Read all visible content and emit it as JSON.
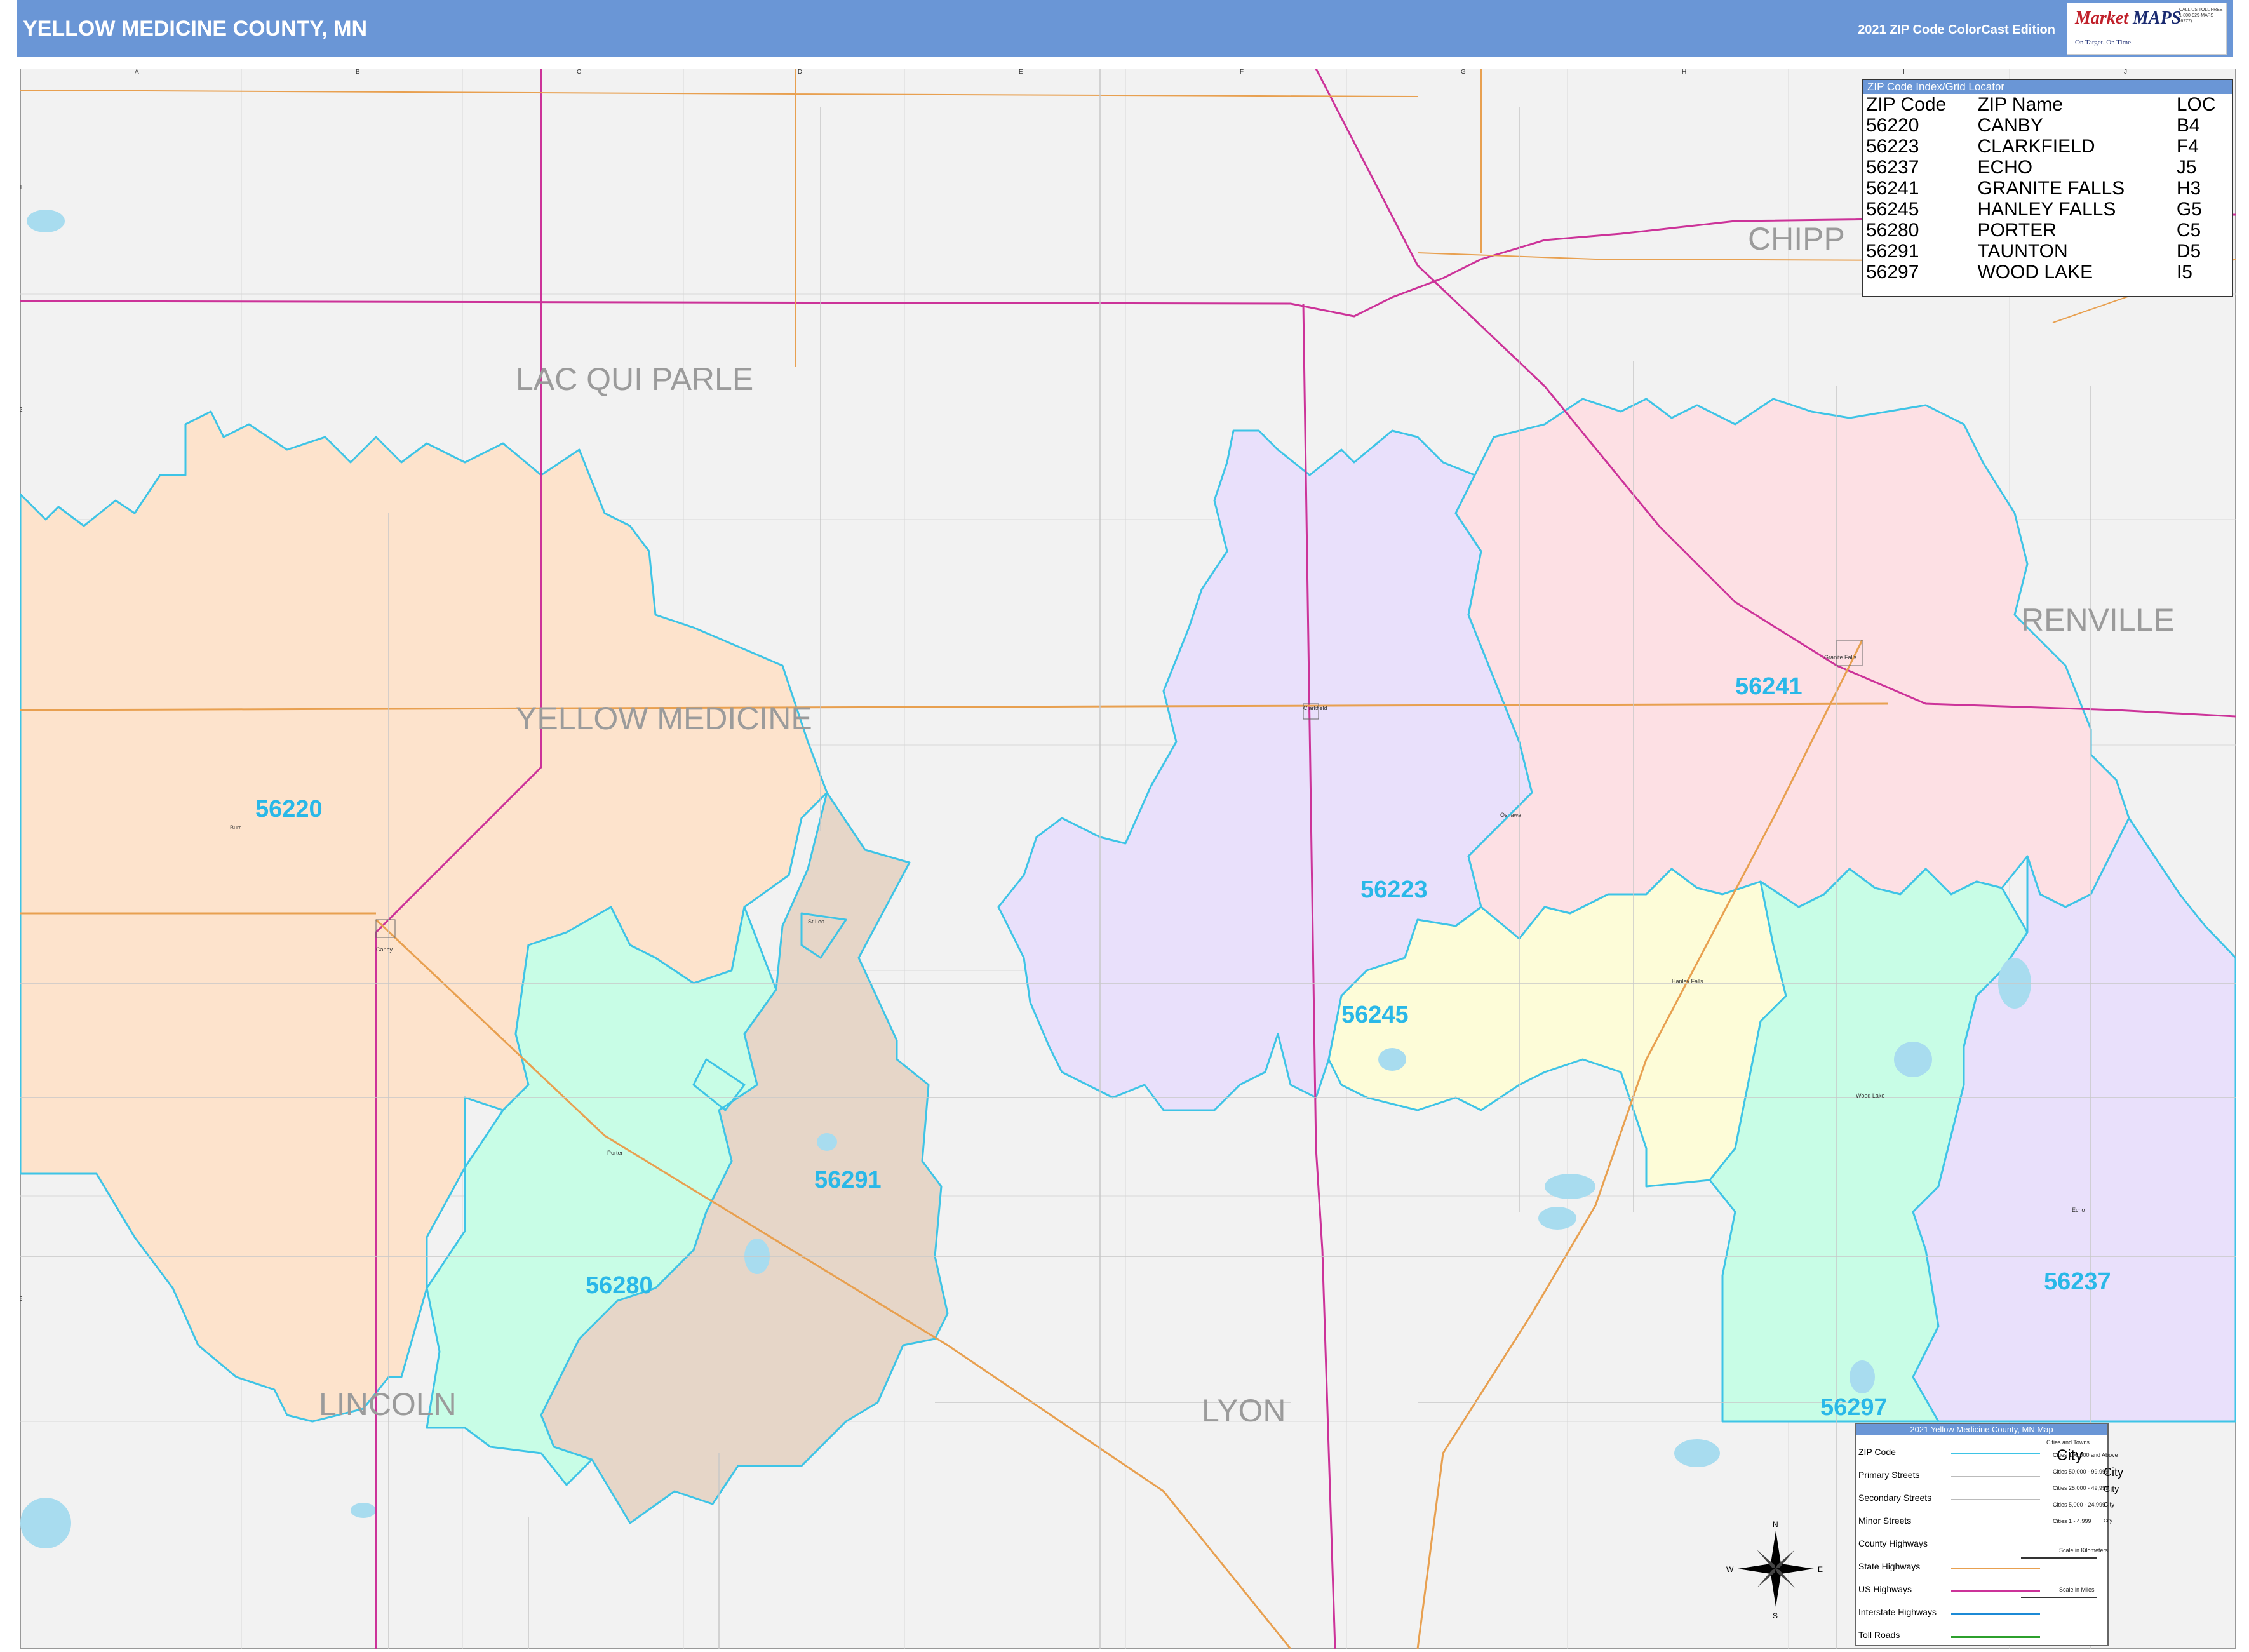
{
  "header": {
    "title": "YELLOW MEDICINE COUNTY, MN",
    "edition": "2021 ZIP Code ColorCast Edition"
  },
  "logo": {
    "name_line1": "Market",
    "name_line2": "MAPS",
    "tagline": "On Target. On Time.",
    "tagline2": "America's Leading Source of Business Maps",
    "contact": "CALL US TOLL FREE 1-800-929-MAPS (6277)"
  },
  "grid": {
    "columns": [
      "A",
      "B",
      "C",
      "D",
      "E",
      "F",
      "G",
      "H",
      "I",
      "J"
    ],
    "rows": [
      "1",
      "2",
      "3",
      "4",
      "5",
      "6",
      "7"
    ]
  },
  "region_labels": {
    "lac_qui_parle": "LAC QUI PARLE",
    "yellow_medicine": "YELLOW MEDICINE",
    "chippewa": "CHIPP",
    "renville": "RENVILLE",
    "lincoln": "LINCOLN",
    "lyon": "LYON"
  },
  "zip_labels": {
    "z56220": "56220",
    "z56223": "56223",
    "z56241": "56241",
    "z56245": "56245",
    "z56291": "56291",
    "z56280": "56280",
    "z56237": "56237",
    "z56297": "56297"
  },
  "town_labels": {
    "canby": "Canby",
    "clarkfield": "Clarkfield",
    "granite_falls": "Granite Falls",
    "hanley_falls": "Hanley Falls",
    "wood_lake": "Wood Lake",
    "porter": "Porter",
    "echo": "Echo",
    "st_leo": "St Leo",
    "burr": "Burr",
    "oshawa": "Oshawa"
  },
  "zip_index": {
    "title": "ZIP Code Index/Grid Locator",
    "headers": [
      "ZIP Code",
      "ZIP Name",
      "LOC"
    ],
    "rows": [
      [
        "56220",
        "CANBY",
        "B4"
      ],
      [
        "56223",
        "CLARKFIELD",
        "F4"
      ],
      [
        "56237",
        "ECHO",
        "J5"
      ],
      [
        "56241",
        "GRANITE FALLS",
        "H3"
      ],
      [
        "56245",
        "HANLEY FALLS",
        "G5"
      ],
      [
        "56280",
        "PORTER",
        "C5"
      ],
      [
        "56291",
        "TAUNTON",
        "D5"
      ],
      [
        "56297",
        "WOOD LAKE",
        "I5"
      ]
    ]
  },
  "legend": {
    "title": "2021 Yellow Medicine County, MN Map",
    "col_header_cities": "Cities and Towns",
    "items": [
      "ZIP Code",
      "Primary Streets",
      "Secondary Streets",
      "Minor Streets",
      "County Highways",
      "State Highways",
      "US Highways",
      "Interstate Highways",
      "Toll Roads"
    ],
    "cities": [
      [
        "Cities 100,000 and Above",
        "City"
      ],
      [
        "Cities 50,000 - 99,999",
        "City"
      ],
      [
        "Cities 25,000 - 49,999",
        "City"
      ],
      [
        "Cities 5,000 - 24,999",
        "City"
      ],
      [
        "Cities 1 - 4,999",
        "City"
      ]
    ],
    "scale_km": "Scale in Kilometers",
    "scale_mi": "Scale in Miles"
  },
  "compass": {
    "n": "N",
    "s": "S",
    "e": "E",
    "w": "W"
  },
  "colors": {
    "header_bg": "#6a96d6",
    "zip_label": "#2ab8e8",
    "zip_boundary": "#3ec4e6",
    "z56220": "#fde3cc",
    "z56223": "#e9e0fb",
    "z56241": "#fde0e4",
    "z56245": "#fdfcd8",
    "z56291": "#e6d6c8",
    "z56280": "#c8fde6",
    "z56237": "#e9e0fb",
    "z56297": "#c8fde6",
    "us_highway": "#cc3399",
    "state_highway": "#e8a050",
    "background": "#f2f2f2"
  }
}
